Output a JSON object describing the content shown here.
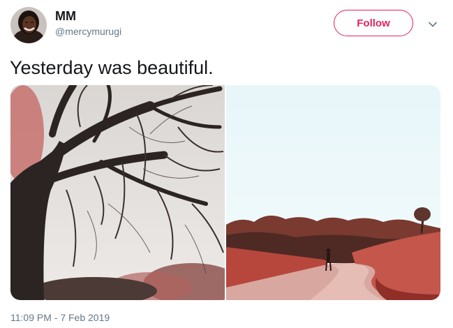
{
  "user": {
    "display_name": "MM",
    "handle": "@mercymurugi"
  },
  "actions": {
    "follow_label": "Follow",
    "more_icon": "chevron-down-icon"
  },
  "tweet": {
    "text": "Yesterday was beautiful.",
    "timestamp": "11:09 PM - 7 Feb 2019"
  },
  "colors": {
    "accent": "#e0245e",
    "text_primary": "#14171a",
    "text_secondary": "#657786"
  }
}
